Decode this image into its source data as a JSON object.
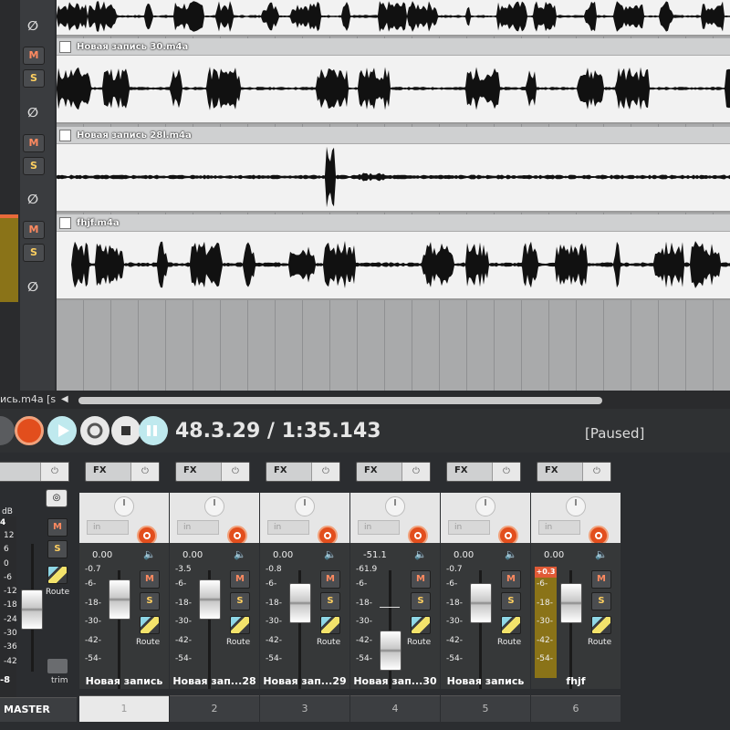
{
  "tracks": [
    {
      "name": "",
      "mute": "M",
      "solo": "S",
      "phase": "∅"
    },
    {
      "name": "Новая запись 30.m4a",
      "mute": "M",
      "solo": "S",
      "phase": "∅"
    },
    {
      "name": "Новая запись 28l.m4a",
      "mute": "M",
      "solo": "S",
      "phase": "∅"
    },
    {
      "name": "fhjf.m4a",
      "mute": "M",
      "solo": "S",
      "phase": "∅"
    }
  ],
  "scrollbar": {
    "label": "ись.m4a [s"
  },
  "transport": {
    "time": "48.3.29 / 1:35.143",
    "status": "[Paused]"
  },
  "mixer": {
    "master": {
      "db_label": "dB",
      "db_top": "4",
      "scale": [
        "12",
        "6",
        "0",
        "-6",
        "-12",
        "-18",
        "-24",
        "-30",
        "-36",
        "-42"
      ],
      "mute": "M",
      "solo": "S",
      "route": "Route",
      "trim": "trim",
      "bottom": "-8",
      "name": "MASTER"
    },
    "strips": [
      {
        "fx": "FX",
        "in": "in",
        "volume": "0.00",
        "peak": "-0.7",
        "scale": [
          "-6-",
          "-18-",
          "-30-",
          "-42-",
          "-54-"
        ],
        "mute": "M",
        "solo": "S",
        "route": "Route",
        "name": "Новая запись",
        "number": "1"
      },
      {
        "fx": "FX",
        "in": "in",
        "volume": "0.00",
        "peak": "-3.5",
        "scale": [
          "-6-",
          "-18-",
          "-30-",
          "-42-",
          "-54-"
        ],
        "mute": "M",
        "solo": "S",
        "route": "Route",
        "name": "Новая зап...28",
        "number": "2"
      },
      {
        "fx": "FX",
        "in": "in",
        "volume": "0.00",
        "peak": "-0.8",
        "scale": [
          "-6-",
          "-18-",
          "-30-",
          "-42-",
          "-54-"
        ],
        "mute": "M",
        "solo": "S",
        "route": "Route",
        "name": "Новая зап...29",
        "number": "3"
      },
      {
        "fx": "FX",
        "in": "in",
        "volume": "-51.1",
        "peak": "-61.9",
        "scale": [
          "-6-",
          "-18-",
          "-30-",
          "-42-",
          "-54-"
        ],
        "mute": "M",
        "solo": "S",
        "route": "Route",
        "name": "Новая зап...30",
        "number": "4"
      },
      {
        "fx": "FX",
        "in": "in",
        "volume": "0.00",
        "peak": "-0.7",
        "scale": [
          "-6-",
          "-18-",
          "-30-",
          "-42-",
          "-54-"
        ],
        "mute": "M",
        "solo": "S",
        "route": "Route",
        "name": "Новая запись",
        "number": "5"
      },
      {
        "fx": "FX",
        "in": "in",
        "volume": "0.00",
        "peak": "+0.3",
        "scale": [
          "-6-",
          "-18-",
          "-30-",
          "-42-",
          "-54-"
        ],
        "mute": "M",
        "solo": "S",
        "route": "Route",
        "name": "fhjf",
        "number": "6"
      }
    ]
  },
  "colors": {
    "record": "#e24e1d",
    "meter": "#8a7318",
    "waveform": "#111111",
    "lane_bg": "#f2f2f2"
  }
}
